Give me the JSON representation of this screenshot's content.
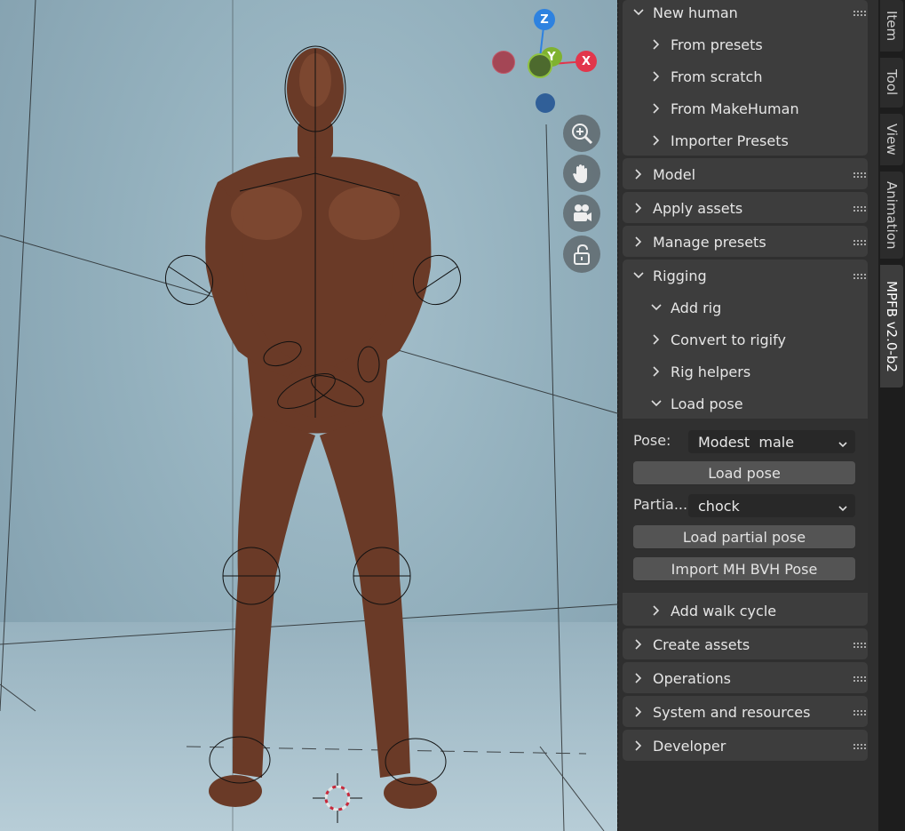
{
  "gizmo": {
    "z_label": "Z",
    "y_label": "Y",
    "x_label": "X",
    "colors": {
      "x": "#e2364b",
      "y": "#7fb22f",
      "z": "#2e82e0",
      "neg_x": "#a44655",
      "neg_y": "#4d6a2e",
      "neg_z": "#305f98"
    }
  },
  "nav_buttons": [
    "zoom-icon",
    "hand-pan-icon",
    "camera-icon",
    "lock-icon"
  ],
  "sidebar": {
    "new_human": {
      "label": "New human",
      "items": [
        "From presets",
        "From scratch",
        "From MakeHuman",
        "Importer Presets"
      ]
    },
    "model": {
      "label": "Model"
    },
    "apply_assets": {
      "label": "Apply assets"
    },
    "manage_presets": {
      "label": "Manage presets"
    },
    "rigging": {
      "label": "Rigging",
      "items": {
        "add_rig": "Add rig",
        "convert_to_rigify": "Convert to rigify",
        "rig_helpers": "Rig helpers",
        "load_pose": "Load pose",
        "add_walk_cycle": "Add walk cycle"
      },
      "load_pose_panel": {
        "pose_label": "Pose:",
        "pose_value": "Modest  male",
        "load_pose_button": "Load pose",
        "partial_label": "Partia...",
        "partial_value": "chock",
        "load_partial_button": "Load partial pose",
        "import_bvh_button": "Import MH BVH Pose"
      }
    },
    "create_assets": {
      "label": "Create assets"
    },
    "operations": {
      "label": "Operations"
    },
    "system_resources": {
      "label": "System and resources"
    },
    "developer": {
      "label": "Developer"
    }
  },
  "tabs": [
    "Item",
    "Tool",
    "View",
    "Animation",
    "MPFB v2.0-b2"
  ],
  "active_tab": "MPFB v2.0-b2"
}
